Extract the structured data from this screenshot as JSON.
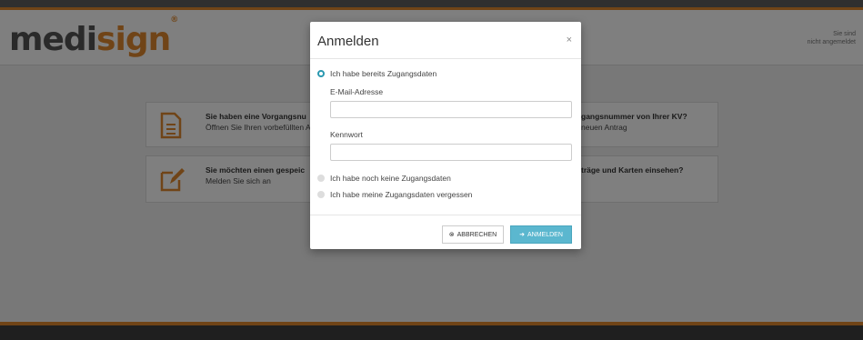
{
  "header": {
    "logo_main": "medi",
    "logo_accent": "sign",
    "logo_reg": "®",
    "login_status_line1": "Sie sind",
    "login_status_line2": "nicht angemeldet"
  },
  "cards": [
    {
      "title": "Sie haben eine Vorgangsnu",
      "subtitle": "Öffnen Sie Ihren vorbefüllten A"
    },
    {
      "title": "Sie möchten einen gespeic",
      "subtitle": "Melden Sie sich an"
    },
    {
      "title": "gangsnummer von Ihrer KV?",
      "subtitle": "neuen Antrag"
    },
    {
      "title": "träge und Karten einsehen?",
      "subtitle": ""
    }
  ],
  "modal": {
    "title": "Anmelden",
    "close_glyph": "×",
    "option_have_credentials": "Ich habe bereits Zugangsdaten",
    "email_label": "E-Mail-Adresse",
    "email_value": "",
    "password_label": "Kennwort",
    "password_value": "",
    "option_no_credentials": "Ich habe noch keine Zugangsdaten",
    "option_forgot_credentials": "Ich habe meine Zugangsdaten vergessen",
    "cancel_label": "ABBRECHEN",
    "login_label": "ANMELDEN"
  },
  "colors": {
    "accent": "#e0892f",
    "primary_button": "#5bb7cf",
    "radio_selected": "#2a98b0"
  }
}
